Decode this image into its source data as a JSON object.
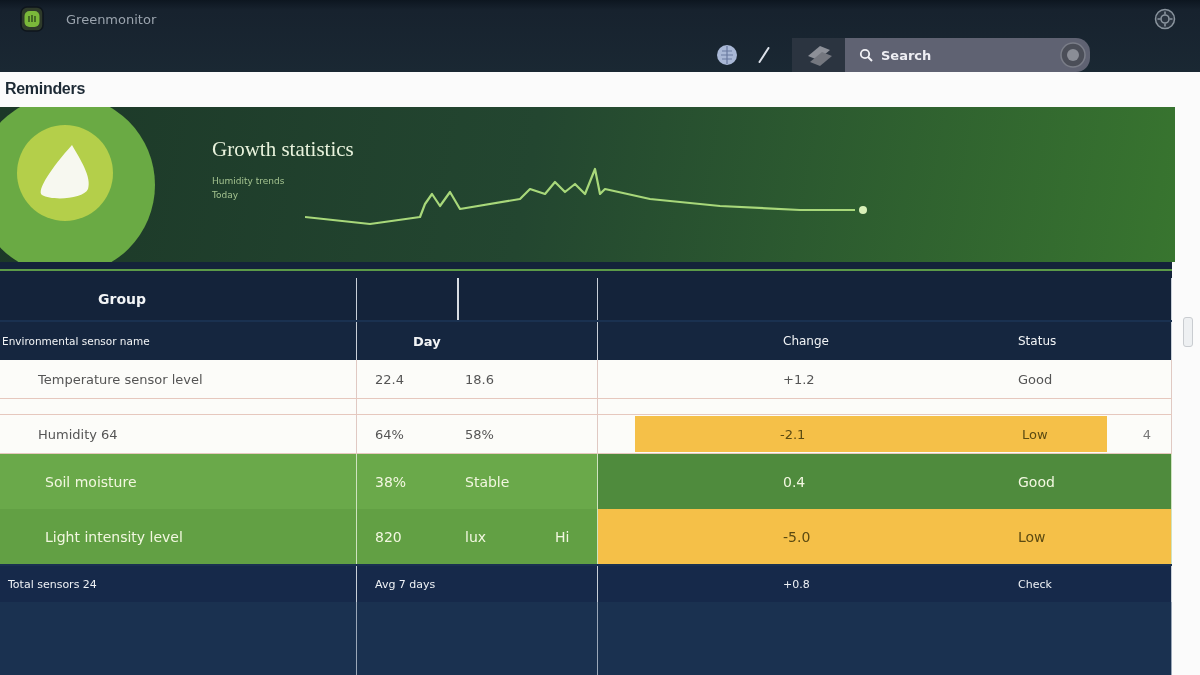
{
  "app": {
    "title": "Greenmonitor"
  },
  "toolbar": {
    "search": {
      "placeholder": "Search"
    }
  },
  "page": {
    "title": "Reminders"
  },
  "banner": {
    "title": "Growth statistics",
    "labels": [
      "Humidity trends",
      "Today"
    ]
  },
  "table": {
    "group_header": "Group",
    "columns": [
      "Environmental sensor name",
      "Day",
      "Change",
      "Status"
    ],
    "rows": [
      {
        "kind": "plain",
        "name": "Temperature sensor level",
        "values": [
          "22.4",
          "18.6"
        ],
        "status": {
          "change": "+1.2",
          "label": "Good"
        }
      },
      {
        "kind": "plain",
        "name": "Humidity 64",
        "values": [
          "64%",
          "58%"
        ],
        "status": {
          "change": "-2.1",
          "label": "Low",
          "color": "#f5c048"
        },
        "note": "4"
      },
      {
        "kind": "highlight",
        "name": "Soil moisture",
        "values": [
          "38%",
          "Stable"
        ],
        "status": {
          "change": "0.4",
          "label": "Good",
          "color": "#4f8b3d"
        }
      },
      {
        "kind": "highlight",
        "name": "Light intensity level",
        "values": [
          "820",
          "lux",
          "Hi"
        ],
        "status": {
          "change": "-5.0",
          "label": "Low",
          "color": "#f5c048"
        }
      },
      {
        "kind": "total",
        "name": "Total sensors 24",
        "values": [
          "Avg 7 days"
        ],
        "status": {
          "change": "+0.8",
          "label": "Check"
        }
      }
    ]
  }
}
